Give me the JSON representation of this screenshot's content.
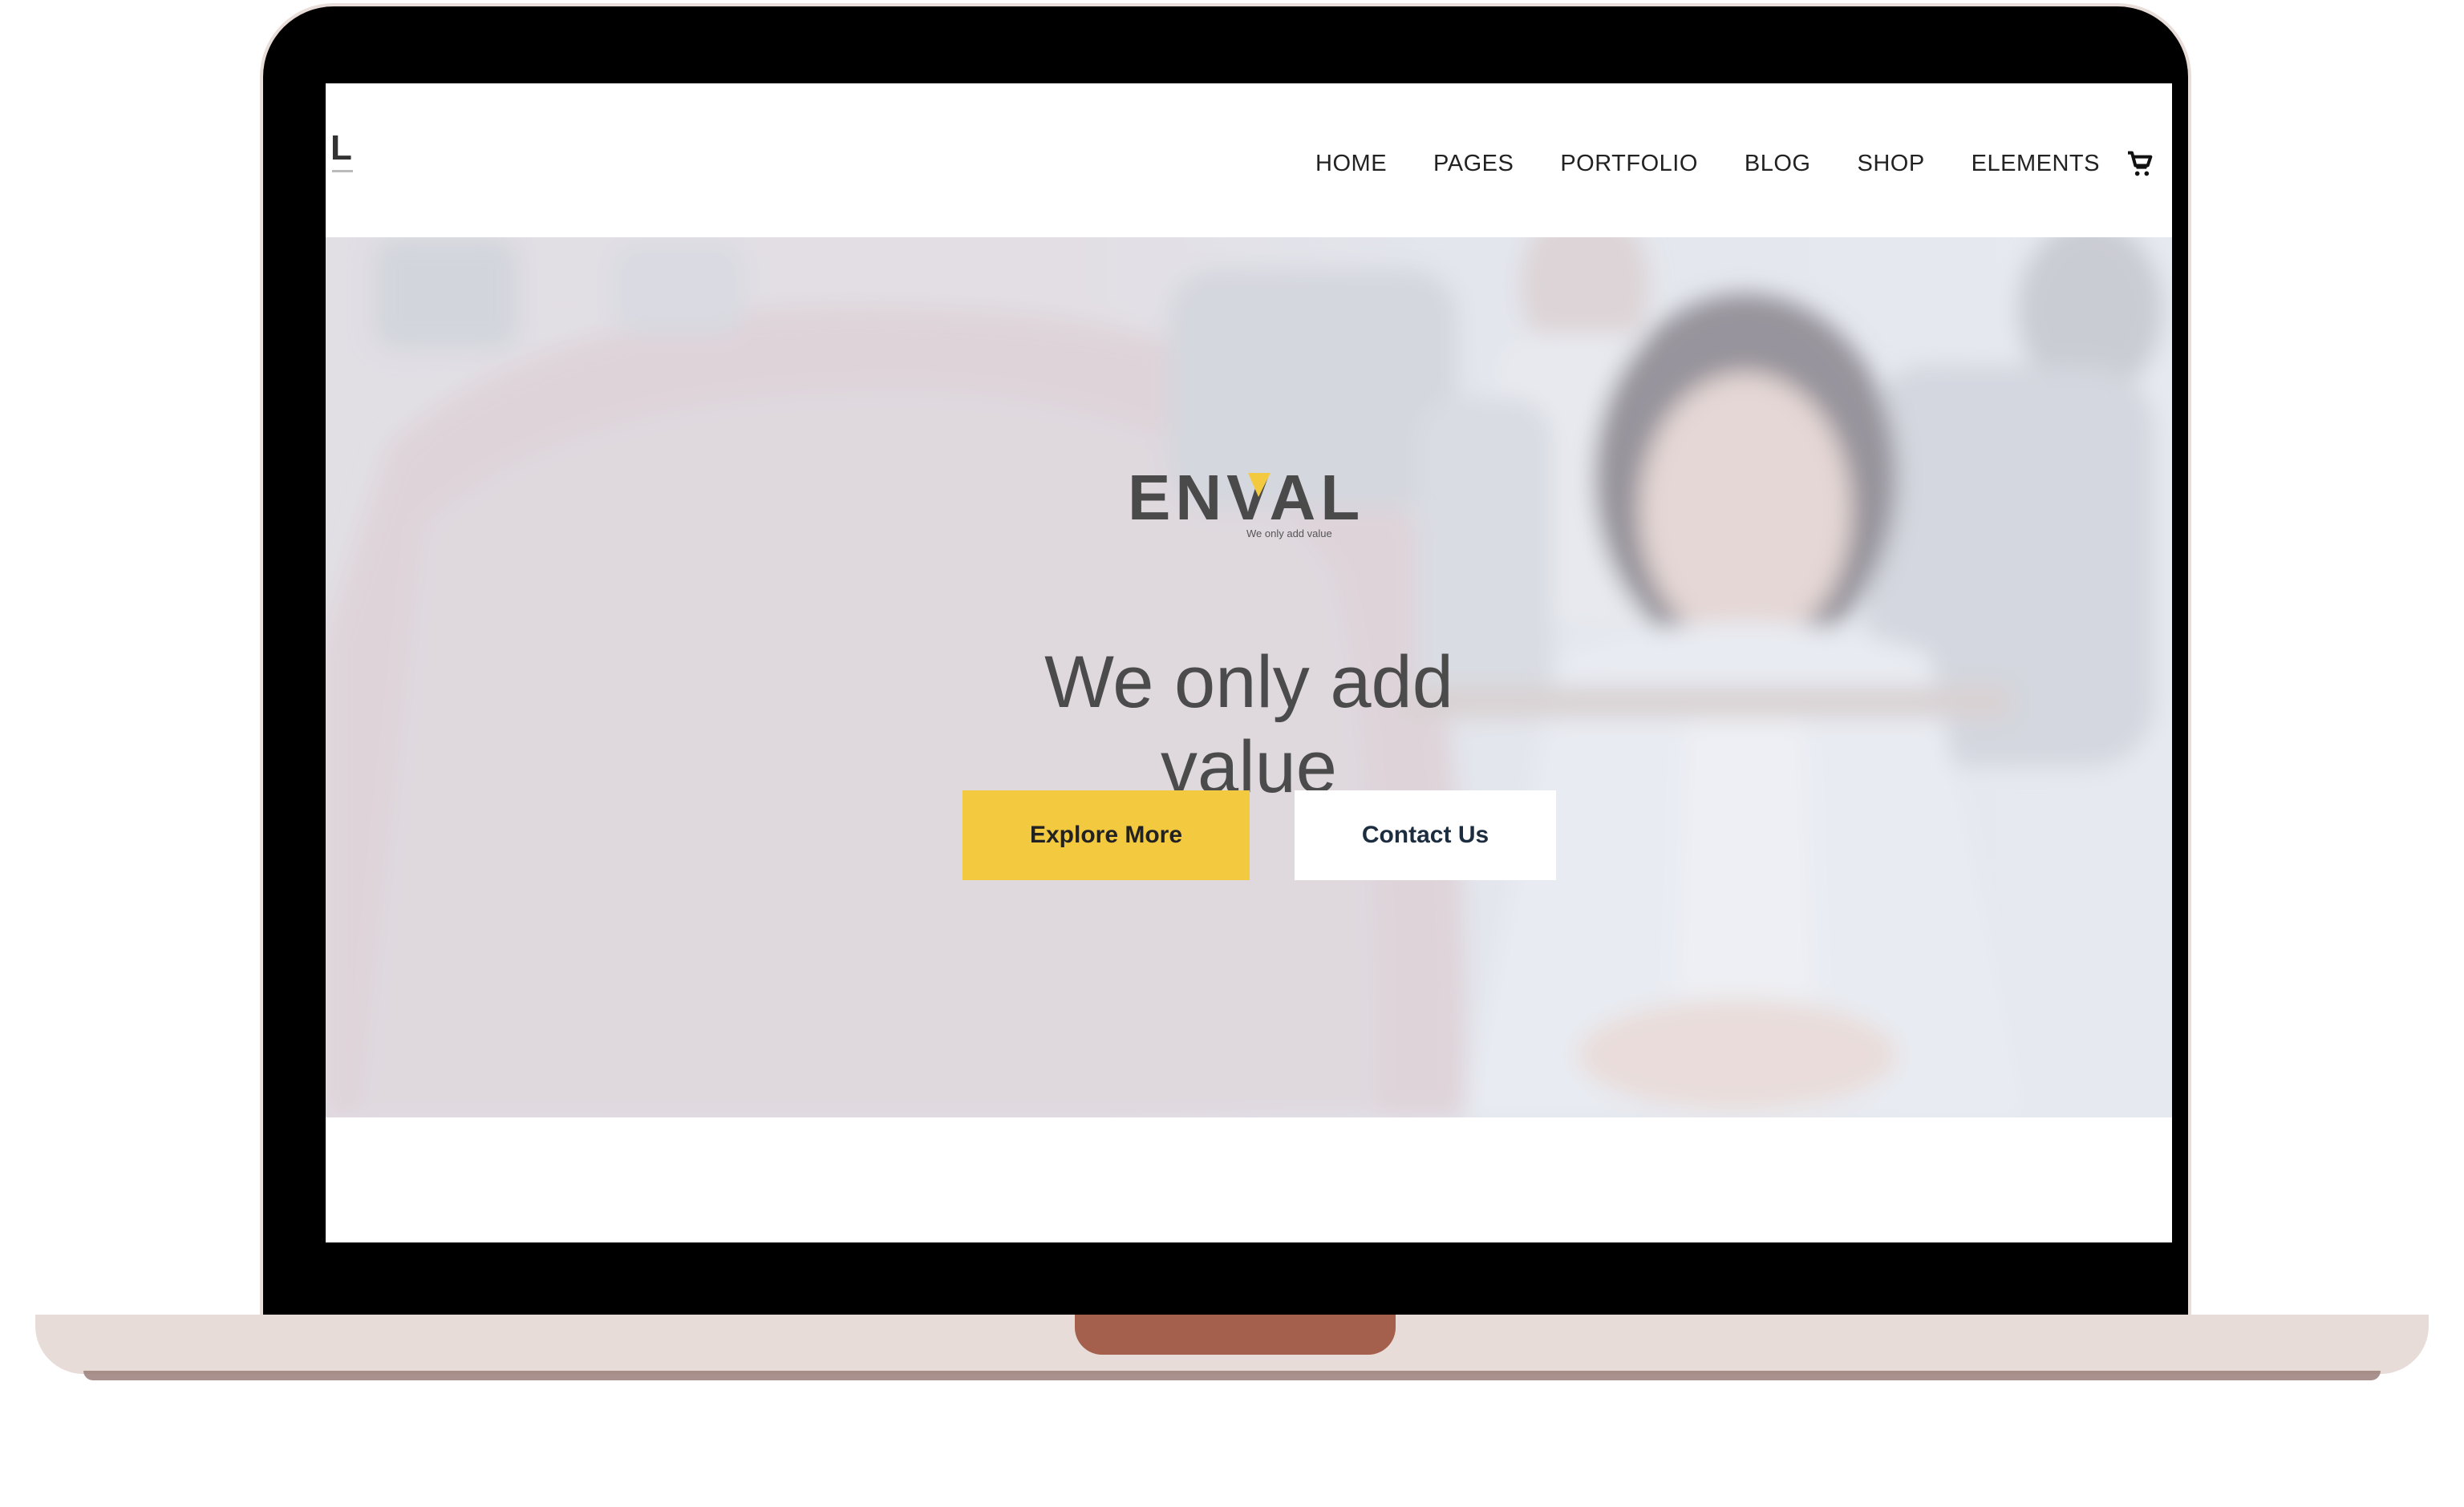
{
  "site": {
    "logo_letter": "L",
    "nav": [
      "HOME",
      "PAGES",
      "PORTFOLIO",
      "BLOG",
      "SHOP",
      "ELEMENTS"
    ],
    "cart_icon": "cart-icon"
  },
  "hero": {
    "brand_logo": "ENVAL",
    "brand_tagline": "We only add value",
    "title": "We only add value",
    "explore_label": "Explore More",
    "contact_label": "Contact Us"
  },
  "colors": {
    "accent": "#f3c93f",
    "frame": "#000000",
    "base": "#e7dcd7",
    "notch": "#a4604d"
  }
}
